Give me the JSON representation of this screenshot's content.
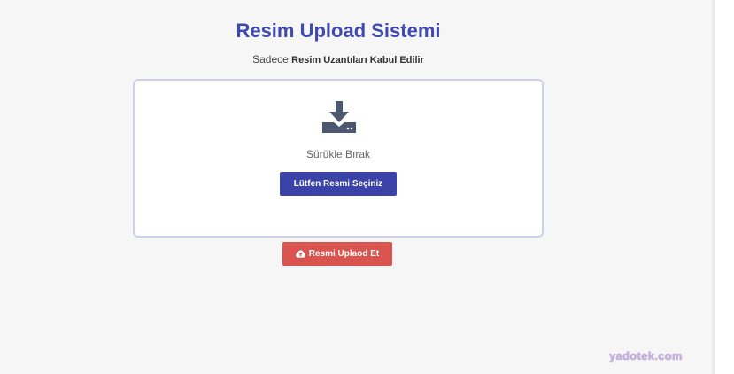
{
  "header": {
    "title": "Resim Upload Sistemi",
    "subtitle_prefix": "Sadece",
    "subtitle_strong": "Resim Uzantıları Kabul Edilir"
  },
  "dropzone": {
    "icon": "download-icon",
    "drop_text": "Sürükle Bırak",
    "select_label": "Lütfen Resmi Seçiniz"
  },
  "upload": {
    "icon": "cloud-upload-icon",
    "label": "Resmi Uplaod Et"
  },
  "watermark": {
    "text": "yadotek.com"
  },
  "colors": {
    "title": "#3f4ab0",
    "select_button": "#3b43a8",
    "upload_button": "#d9534f",
    "icon": "#4b5870"
  }
}
